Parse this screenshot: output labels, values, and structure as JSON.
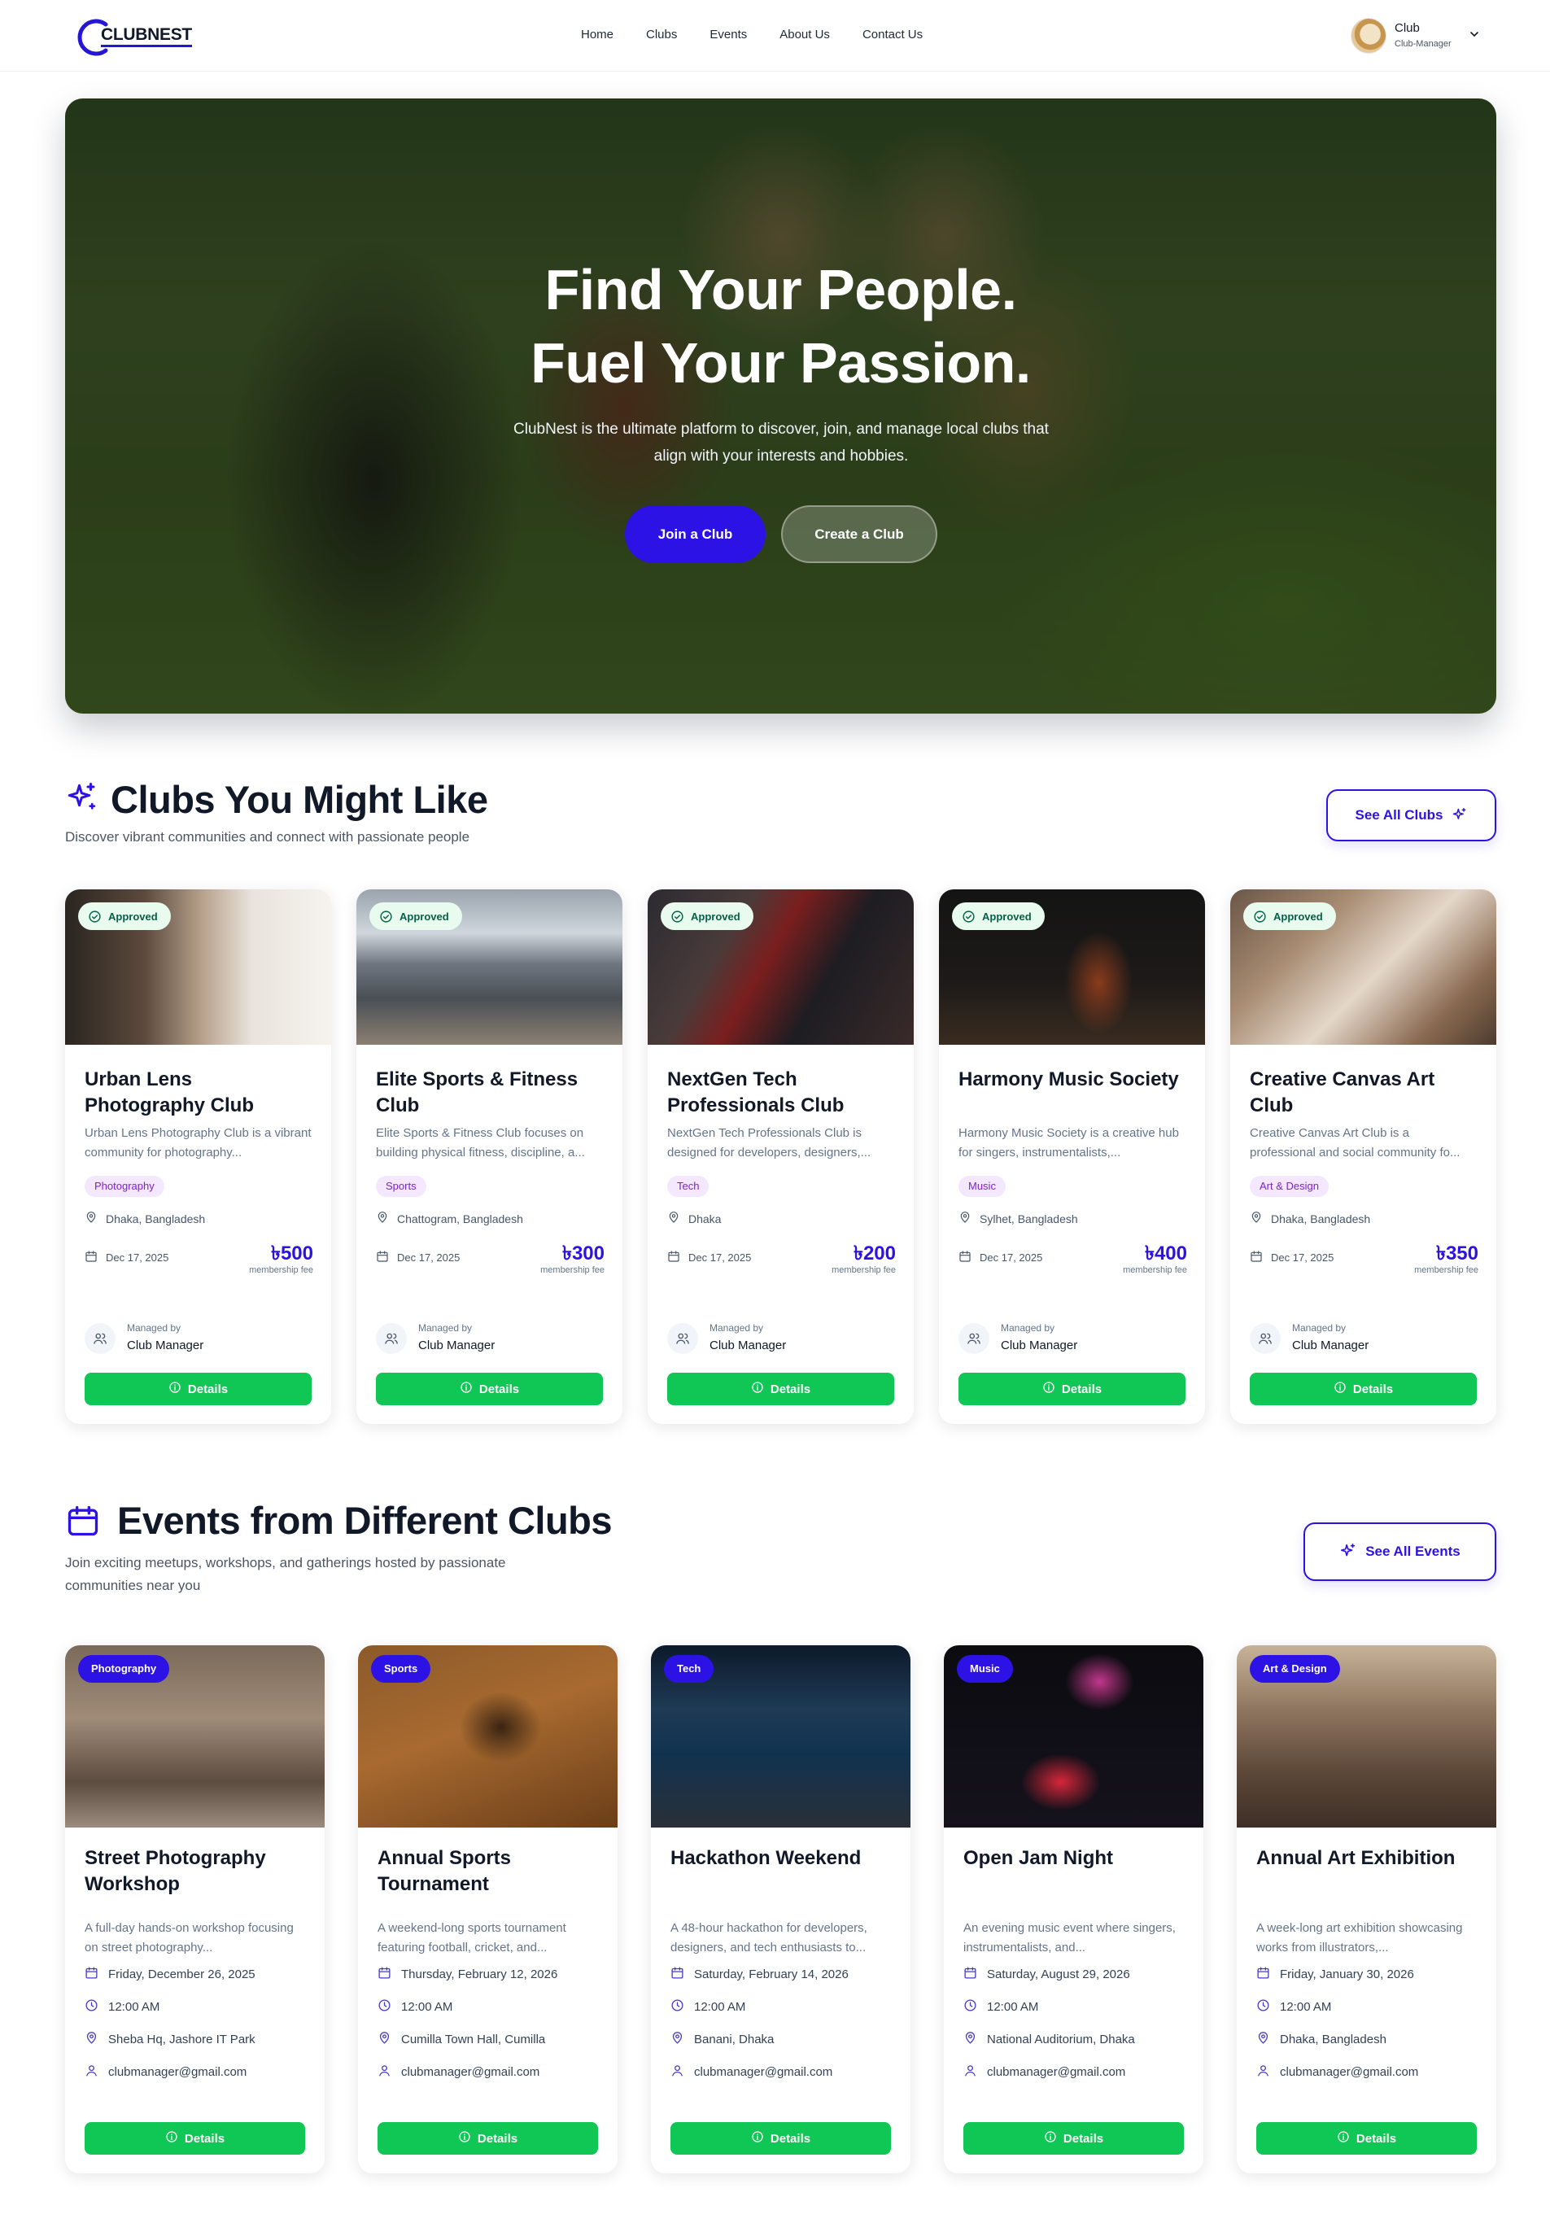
{
  "brand": {
    "logo_text": "CLUBNEST",
    "accent": "#2d12e6",
    "success": "#10c655"
  },
  "nav": {
    "links": [
      "Home",
      "Clubs",
      "Events",
      "About Us",
      "Contact Us"
    ],
    "user_name": "Club",
    "user_role": "Club-Manager"
  },
  "hero": {
    "title_line1": "Find Your People.",
    "title_line2": "Fuel Your Passion.",
    "subtitle": "ClubNest is the ultimate platform to discover, join, and manage local clubs that align with your interests and hobbies.",
    "join_label": "Join a Club",
    "create_label": "Create a Club"
  },
  "clubs_section": {
    "title": "Clubs You Might Like",
    "description": "Discover vibrant communities and connect with passionate people",
    "see_all": "See All Clubs",
    "clubs": [
      {
        "status": "Approved",
        "name": "Urban Lens Photography Club",
        "description": "Urban Lens Photography Club is a vibrant community for photography...",
        "tag": "Photography",
        "location": "Dhaka, Bangladesh",
        "date": "Dec 17, 2025",
        "fee": "৳500",
        "fee_label": "membership fee",
        "managed_by": "Managed by",
        "manager": "Club Manager",
        "details": "Details"
      },
      {
        "status": "Approved",
        "name": "Elite Sports & Fitness Club",
        "description": "Elite Sports & Fitness Club focuses on building physical fitness, discipline, a...",
        "tag": "Sports",
        "location": "Chattogram, Bangladesh",
        "date": "Dec 17, 2025",
        "fee": "৳300",
        "fee_label": "membership fee",
        "managed_by": "Managed by",
        "manager": "Club Manager",
        "details": "Details"
      },
      {
        "status": "Approved",
        "name": "NextGen Tech Professionals Club",
        "description": "NextGen Tech Professionals Club is designed for developers, designers,...",
        "tag": "Tech",
        "location": "Dhaka",
        "date": "Dec 17, 2025",
        "fee": "৳200",
        "fee_label": "membership fee",
        "managed_by": "Managed by",
        "manager": "Club Manager",
        "details": "Details"
      },
      {
        "status": "Approved",
        "name": "Harmony Music Society",
        "description": "Harmony Music Society is a creative hub for singers, instrumentalists,...",
        "tag": "Music",
        "location": "Sylhet, Bangladesh",
        "date": "Dec 17, 2025",
        "fee": "৳400",
        "fee_label": "membership fee",
        "managed_by": "Managed by",
        "manager": "Club Manager",
        "details": "Details"
      },
      {
        "status": "Approved",
        "name": "Creative Canvas Art Club",
        "description": "Creative Canvas Art Club is a professional and social community fo...",
        "tag": "Art & Design",
        "location": "Dhaka, Bangladesh",
        "date": "Dec 17, 2025",
        "fee": "৳350",
        "fee_label": "membership fee",
        "managed_by": "Managed by",
        "manager": "Club Manager",
        "details": "Details"
      }
    ]
  },
  "events_section": {
    "title": "Events from Different Clubs",
    "description": "Join exciting meetups, workshops, and gatherings hosted by passionate communities near you",
    "see_all": "See All Events",
    "events": [
      {
        "category": "Photography",
        "title": "Street Photography Workshop",
        "description": "A full-day hands-on workshop focusing on street photography...",
        "date": "Friday, December 26, 2025",
        "time": "12:00 AM",
        "location": "Sheba Hq, Jashore IT Park",
        "email": "clubmanager@gmail.com",
        "details": "Details"
      },
      {
        "category": "Sports",
        "title": "Annual Sports Tournament",
        "description": "A weekend-long sports tournament featuring football, cricket, and...",
        "date": "Thursday, February 12, 2026",
        "time": "12:00 AM",
        "location": "Cumilla Town Hall, Cumilla",
        "email": "clubmanager@gmail.com",
        "details": "Details"
      },
      {
        "category": "Tech",
        "title": "Hackathon Weekend",
        "description": "A 48-hour hackathon for developers, designers, and tech enthusiasts to...",
        "date": "Saturday, February 14, 2026",
        "time": "12:00 AM",
        "location": "Banani, Dhaka",
        "email": "clubmanager@gmail.com",
        "details": "Details"
      },
      {
        "category": "Music",
        "title": "Open Jam Night",
        "description": "An evening music event where singers, instrumentalists, and...",
        "date": "Saturday, August 29, 2026",
        "time": "12:00 AM",
        "location": "National Auditorium, Dhaka",
        "email": "clubmanager@gmail.com",
        "details": "Details"
      },
      {
        "category": "Art & Design",
        "title": "Annual Art Exhibition",
        "description": "A week-long art exhibition showcasing works from illustrators,...",
        "date": "Friday, January 30, 2026",
        "time": "12:00 AM",
        "location": "Dhaka, Bangladesh",
        "email": "clubmanager@gmail.com",
        "details": "Details"
      }
    ]
  }
}
